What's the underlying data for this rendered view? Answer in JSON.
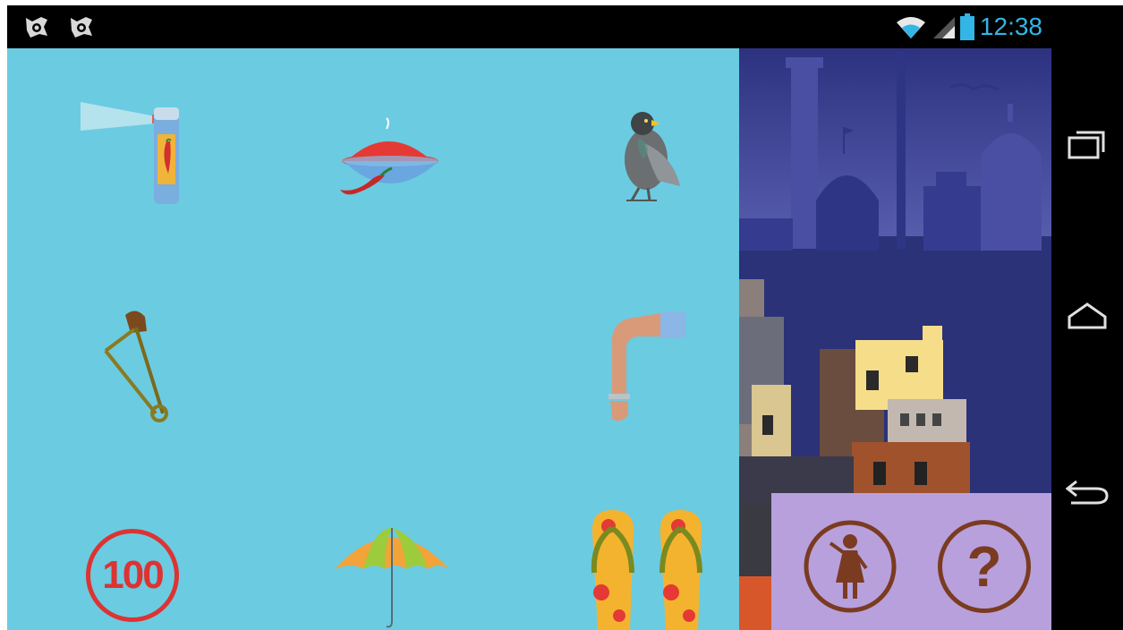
{
  "status_bar": {
    "time": "12:38",
    "notification_icons": [
      "app-notification-icon",
      "app-notification-icon"
    ],
    "wifi_icon": "wifi-icon",
    "signal_icon": "signal-icon",
    "battery_icon": "battery-icon",
    "accent": "#33b5e5"
  },
  "game": {
    "background": "#6bcbe1",
    "items": [
      {
        "name": "chilli-spray-can",
        "icon": "pepper-spray-icon"
      },
      {
        "name": "chilli-powder-bowl",
        "icon": "chilli-powder-icon"
      },
      {
        "name": "pigeon",
        "icon": "pigeon-icon"
      },
      {
        "name": "safety-pin",
        "icon": "safety-pin-icon"
      },
      {
        "name": "arm-bangle",
        "icon": "arm-icon"
      },
      {
        "name": "helpline-100",
        "label": "100",
        "icon": "helpline-badge-icon"
      },
      {
        "name": "umbrella",
        "icon": "umbrella-icon"
      },
      {
        "name": "flip-flops",
        "icon": "slippers-icon"
      }
    ]
  },
  "side_panel": {
    "illustration": "city-skyline-illustration",
    "controls": {
      "background": "#b8a0dd",
      "left_button_icon": "girl-figure-icon",
      "help_label": "?"
    }
  },
  "nav_bar": {
    "buttons": [
      "recent-apps-icon",
      "home-icon",
      "back-icon"
    ]
  }
}
